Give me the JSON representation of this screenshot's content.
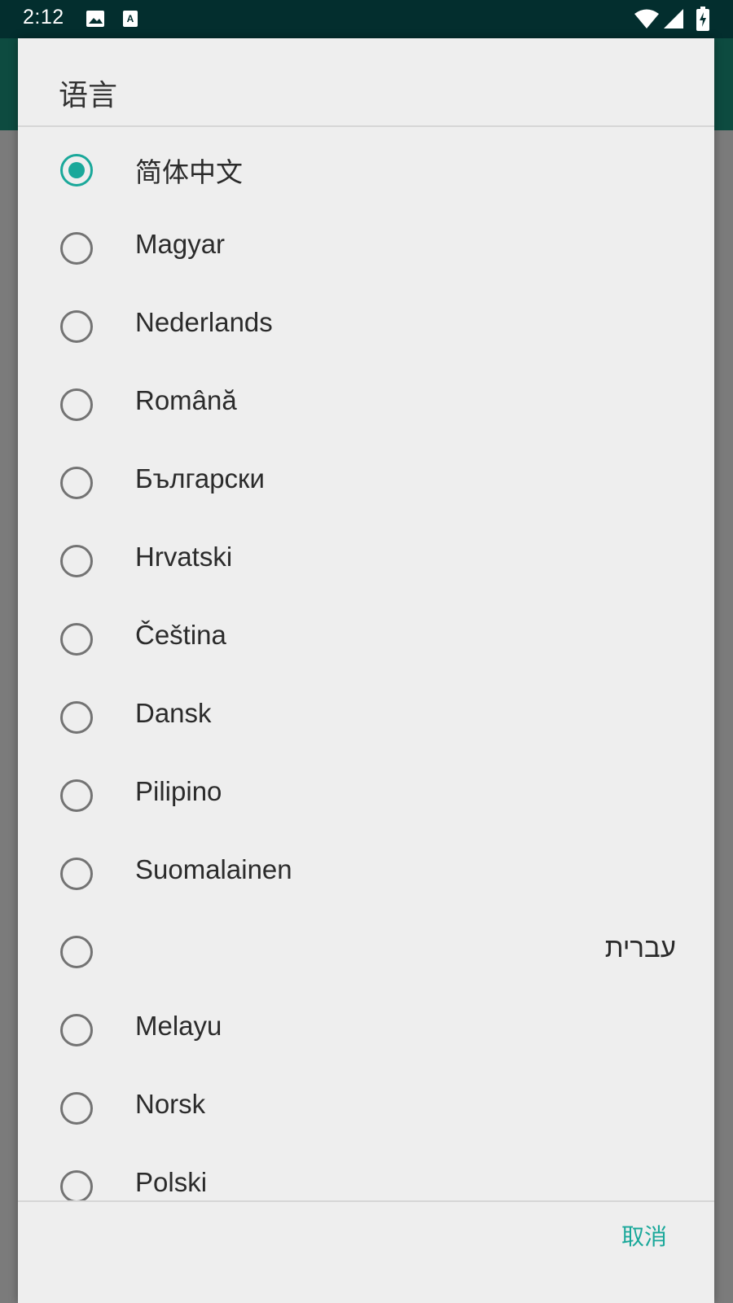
{
  "status_bar": {
    "time": "2:12",
    "icons": [
      "image-icon",
      "a-icon",
      "wifi-icon",
      "signal-icon",
      "battery-charging-icon"
    ]
  },
  "colors": {
    "accent": "#1aa89a",
    "status_bar": "#032e2e",
    "dialog_bg": "#eeeeee",
    "radio_unchecked": "#737373"
  },
  "dialog": {
    "title": "语言",
    "cancel_label": "取消",
    "options": [
      {
        "label": "简体中文",
        "checked": true
      },
      {
        "label": "Magyar",
        "checked": false
      },
      {
        "label": "Nederlands",
        "checked": false
      },
      {
        "label": "Română",
        "checked": false
      },
      {
        "label": "Български",
        "checked": false
      },
      {
        "label": "Hrvatski",
        "checked": false
      },
      {
        "label": "Čeština",
        "checked": false
      },
      {
        "label": "Dansk",
        "checked": false
      },
      {
        "label": "Pilipino",
        "checked": false
      },
      {
        "label": "Suomalainen",
        "checked": false
      },
      {
        "label": "עברית",
        "checked": false
      },
      {
        "label": "Melayu",
        "checked": false
      },
      {
        "label": "Norsk",
        "checked": false
      },
      {
        "label": "Polski",
        "checked": false
      }
    ]
  }
}
